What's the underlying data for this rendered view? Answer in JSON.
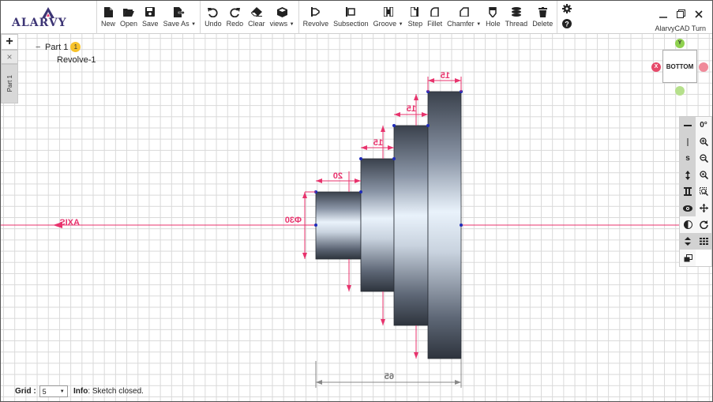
{
  "app": {
    "logo_text": "ALARVY",
    "name": "AlarvyCAD Turn"
  },
  "toolbar": {
    "file": [
      {
        "id": "new",
        "label": "New",
        "icon": "new-file-icon"
      },
      {
        "id": "open",
        "label": "Open",
        "icon": "folder-open-icon"
      },
      {
        "id": "save",
        "label": "Save",
        "icon": "floppy-icon"
      },
      {
        "id": "saveas",
        "label": "Save As",
        "icon": "export-file-icon",
        "dropdown": true
      }
    ],
    "edit": [
      {
        "id": "undo",
        "label": "Undo",
        "icon": "undo-icon"
      },
      {
        "id": "redo",
        "label": "Redo",
        "icon": "redo-icon"
      },
      {
        "id": "clear",
        "label": "Clear",
        "icon": "eraser-icon"
      },
      {
        "id": "views",
        "label": "views",
        "icon": "cube-icon",
        "dropdown": true
      }
    ],
    "features": [
      {
        "id": "revolve",
        "label": "Revolve",
        "icon": "revolve-icon"
      },
      {
        "id": "subsection",
        "label": "Subsection",
        "icon": "subsection-icon"
      },
      {
        "id": "groove",
        "label": "Groove",
        "icon": "groove-icon",
        "dropdown": true
      },
      {
        "id": "step",
        "label": "Step",
        "icon": "step-icon"
      },
      {
        "id": "fillet",
        "label": "Fillet",
        "icon": "fillet-icon"
      },
      {
        "id": "chamfer",
        "label": "Chamfer",
        "icon": "chamfer-icon",
        "dropdown": true
      },
      {
        "id": "hole",
        "label": "Hole",
        "icon": "hole-icon"
      },
      {
        "id": "thread",
        "label": "Thread",
        "icon": "thread-icon"
      },
      {
        "id": "delete",
        "label": "Delete",
        "icon": "trash-icon"
      }
    ]
  },
  "left_tabs": {
    "add": "+",
    "close": "×",
    "part_tab": "Part 1"
  },
  "tree": {
    "root_label": "Part 1",
    "root_badge": "1",
    "children": [
      "Revolve-1"
    ]
  },
  "viewcube": {
    "face_label": "BOTTOM",
    "y_label": "Y",
    "x_label": "X"
  },
  "drawing": {
    "axis_label": "AXIS",
    "dimensions": {
      "diameter": "Φ30",
      "step1_len": "20",
      "step2_len": "15",
      "step3_len": "15",
      "step4_len": "15",
      "total_len": "65"
    }
  },
  "statusbar": {
    "grid_label": "Grid :",
    "grid_value": "5",
    "info_label": "Info",
    "info_text": ": Sketch closed."
  },
  "colors": {
    "dimension": "#e8336d",
    "axis": "#e8336d",
    "x_dot": "#e64a6a",
    "y_dot": "#8fd14f",
    "badge": "#f7c22b",
    "logo": "#3d3575"
  }
}
